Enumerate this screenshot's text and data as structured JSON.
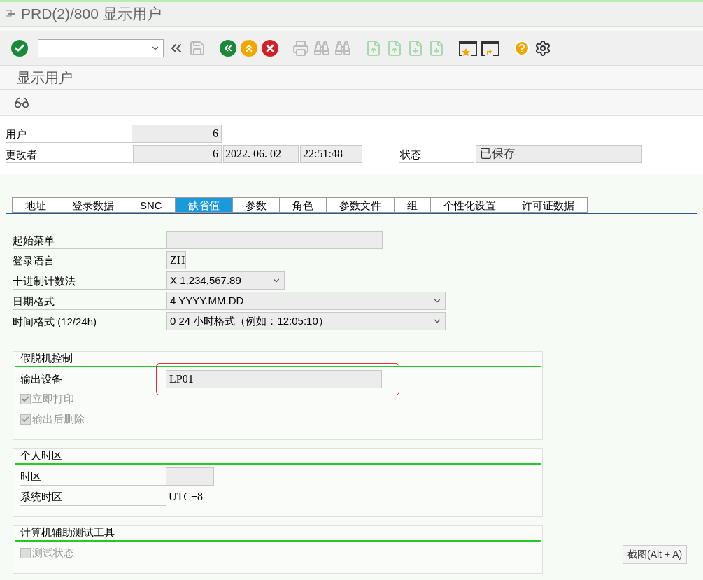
{
  "window": {
    "title": "PRD(2)/800 显示用户"
  },
  "screen_title": "显示用户",
  "header": {
    "user": {
      "label": "用户",
      "value": "6"
    },
    "changed_by": {
      "label": "更改者",
      "value": "6",
      "date": "2022. 06. 02",
      "time": "22:51:48"
    },
    "status": {
      "label": "状态",
      "value": "已保存"
    }
  },
  "tabs": [
    {
      "label": "地址",
      "selected": false
    },
    {
      "label": "登录数据",
      "selected": false
    },
    {
      "label": "SNC",
      "selected": false
    },
    {
      "label": "缺省值",
      "selected": true
    },
    {
      "label": "参数",
      "selected": false
    },
    {
      "label": "角色",
      "selected": false
    },
    {
      "label": "参数文件",
      "selected": false
    },
    {
      "label": "组",
      "selected": false
    },
    {
      "label": "个性化设置",
      "selected": false
    },
    {
      "label": "许可证数据",
      "selected": false
    }
  ],
  "defaults": [
    {
      "kind": "input",
      "label": "起始菜单"
    },
    {
      "kind": "input",
      "label": "登录语言",
      "value": "ZH"
    },
    {
      "kind": "dropdown",
      "label": "十进制计数法",
      "value": "X 1,234,567.89"
    },
    {
      "kind": "dropdown",
      "label": "日期格式",
      "value": "4 YYYY.MM.DD"
    },
    {
      "kind": "dropdown",
      "label": "时间格式 (12/24h)",
      "value": "0 24 小时格式（例如：12:05:10）"
    }
  ],
  "groups": [
    {
      "title": "假脱机控制",
      "rows": [
        {
          "kind": "input",
          "label": "输出设备",
          "value": "LP01",
          "highlighted": true
        },
        {
          "kind": "checkbox",
          "label": "立即打印",
          "checked": true,
          "disabled": true
        },
        {
          "kind": "checkbox",
          "label": "输出后删除",
          "checked": true,
          "disabled": true
        }
      ]
    },
    {
      "title": "个人时区",
      "rows": [
        {
          "kind": "input",
          "label": "时区"
        },
        {
          "kind": "text",
          "label": "系统时区",
          "value": "UTC+8"
        }
      ]
    },
    {
      "title": "计算机辅助测试工具",
      "rows": [
        {
          "kind": "checkbox",
          "label": "测试状态",
          "checked": false,
          "disabled": true
        }
      ]
    }
  ],
  "tooltip": "截图(Alt + A)"
}
